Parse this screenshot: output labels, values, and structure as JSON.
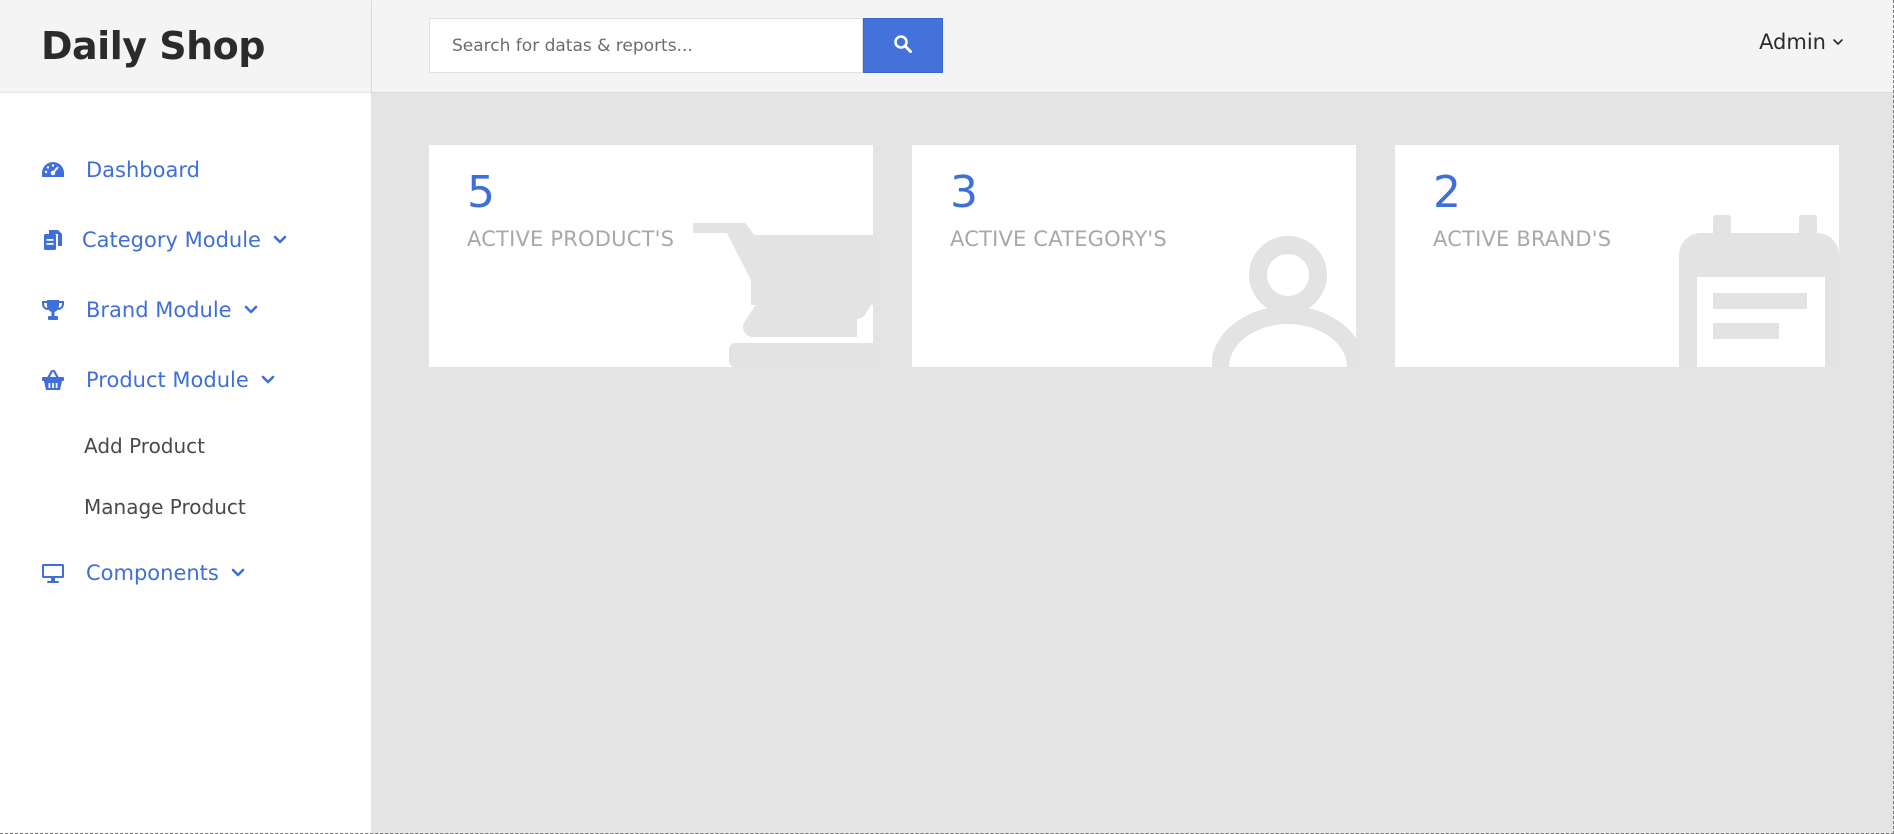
{
  "app": {
    "title": "Daily Shop"
  },
  "search": {
    "placeholder": "Search for datas & reports..."
  },
  "header": {
    "user_label": "Admin"
  },
  "sidebar": {
    "items": [
      {
        "label": "Dashboard",
        "icon": "dashboard-icon"
      },
      {
        "label": "Category Module",
        "icon": "copy-files-icon",
        "expandable": true
      },
      {
        "label": "Brand Module",
        "icon": "trophy-icon",
        "expandable": true
      },
      {
        "label": "Product Module",
        "icon": "basket-icon",
        "expandable": true,
        "expanded": true,
        "children": [
          {
            "label": "Add Product"
          },
          {
            "label": "Manage Product"
          }
        ]
      },
      {
        "label": "Components",
        "icon": "desktop-icon",
        "expandable": true
      }
    ]
  },
  "cards": [
    {
      "count": "5",
      "caption": "ACTIVE PRODUCT'S",
      "icon": "shopping-cart-icon"
    },
    {
      "count": "3",
      "caption": "ACTIVE CATEGORY'S",
      "icon": "user-icon"
    },
    {
      "count": "2",
      "caption": "ACTIVE BRAND'S",
      "icon": "calendar-icon"
    }
  ],
  "colors": {
    "accent": "#4472db",
    "link": "#3f6fd8",
    "content_bg": "#e4e4e4",
    "caption": "#a8a8a8"
  }
}
